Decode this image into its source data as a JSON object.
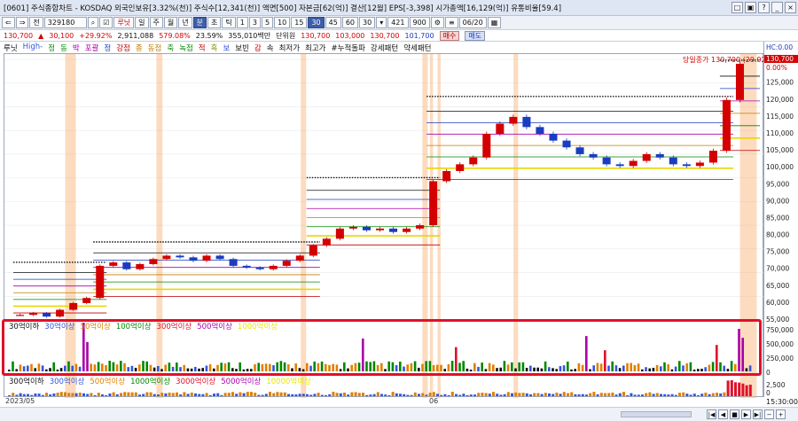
{
  "window": {
    "title": "[0601] 주식종합차트 - KOSDAQ 외국인보유[3.32%(천)] 주식수[12,341(천)] 액면[500] 자본금[62(억)] 결산[12월] EPS[-3,398] 시가총액[16,129(억)] 유통비율[59.4]",
    "buttons": [
      "□",
      "▣",
      "?",
      "_",
      "×"
    ]
  },
  "toolbar": {
    "nav_arrows": [
      "⇐",
      "⇒"
    ],
    "market": "전",
    "code": "329180",
    "search_icon": "search-icon",
    "check": "☑",
    "name_tag": "루닛",
    "periods": [
      "일",
      "주",
      "월",
      "년",
      "분",
      "초",
      "틱"
    ],
    "active_period": "분",
    "numbers": [
      "1",
      "3",
      "5",
      "10",
      "15",
      "30",
      "45",
      "60",
      "30"
    ],
    "active_number": "30",
    "count": "421",
    "count_total": "900",
    "date": "06/20"
  },
  "pricebar": {
    "price": "130,700",
    "change": "30,100",
    "change_pct": "+29.92%",
    "volume": "2,911,088",
    "amount": "579.08%",
    "turnover": "23.59%",
    "value": "355,010백만",
    "trade": "단위원",
    "open": "130,700",
    "high": "103,000",
    "low": "130,700",
    "close": "101,700",
    "buy": "매수",
    "sell": "매도"
  },
  "legend": {
    "items": [
      {
        "label": "루닛",
        "color": "#111111"
      },
      {
        "label": "High-",
        "color": "#3355dd"
      },
      {
        "label": "정",
        "color": "#008800"
      },
      {
        "label": "동",
        "color": "#008800"
      },
      {
        "label": "박",
        "color": "#aa00aa"
      },
      {
        "label": "포괄",
        "color": "#aa00aa"
      },
      {
        "label": "정",
        "color": "#1a3cc0"
      },
      {
        "label": "강점",
        "color": "#c00000"
      },
      {
        "label": "종",
        "color": "#c08000"
      },
      {
        "label": "동점",
        "color": "#c08000"
      },
      {
        "label": "축",
        "color": "#008800"
      },
      {
        "label": "녹점",
        "color": "#008800"
      },
      {
        "label": "적",
        "color": "#c00000"
      },
      {
        "label": "흑",
        "color": "#808000"
      },
      {
        "label": "보",
        "color": "#3355dd"
      },
      {
        "label": "보빈",
        "color": "#111111"
      },
      {
        "label": "감",
        "color": "#c00000"
      },
      {
        "label": "속",
        "color": "#111111"
      },
      {
        "label": "최저가",
        "color": "#111111"
      },
      {
        "label": "최고가",
        "color": "#111111"
      },
      {
        "label": "#누적돌파",
        "color": "#111111"
      },
      {
        "label": "강세패턴",
        "color": "#111111"
      },
      {
        "label": "약세패턴",
        "color": "#111111"
      }
    ],
    "annotation": "당일종가 130,700 (29.92%)"
  },
  "volume_legend_top": [
    {
      "label": "30억이하",
      "color": "#111111"
    },
    {
      "label": "30억이상",
      "color": "#3355dd"
    },
    {
      "label": "50억이상",
      "color": "#e08000"
    },
    {
      "label": "100억이상",
      "color": "#008800"
    },
    {
      "label": "300억이상",
      "color": "#e0102a"
    },
    {
      "label": "500억이상",
      "color": "#aa00aa"
    },
    {
      "label": "1000억이상",
      "color": "#e8e800"
    }
  ],
  "volume_legend_bottom": [
    {
      "label": "300억이하",
      "color": "#111111"
    },
    {
      "label": "300억이상",
      "color": "#3355dd"
    },
    {
      "label": "500억이상",
      "color": "#e08000"
    },
    {
      "label": "1000억이상",
      "color": "#008800"
    },
    {
      "label": "3000억이상",
      "color": "#e0102a"
    },
    {
      "label": "5000억이상",
      "color": "#aa00aa"
    },
    {
      "label": "10000억이상",
      "color": "#e8e800"
    }
  ],
  "yaxis_price": {
    "header": "HC:0.00",
    "labels": [
      "130,700",
      "0.00%",
      "125,000",
      "120,000",
      "115,000",
      "110,000",
      "105,000",
      "100,000",
      "95,000",
      "90,000",
      "85,000",
      "80,000",
      "75,000",
      "70,000",
      "65,000",
      "60,000",
      "55,000"
    ],
    "values": [
      130700,
      null,
      125000,
      120000,
      115000,
      110000,
      105000,
      100000,
      95000,
      90000,
      85000,
      80000,
      75000,
      70000,
      65000,
      60000,
      55000
    ]
  },
  "yaxis_volume": {
    "labels": [
      "750,000",
      "500,000",
      "250,000",
      "0"
    ]
  },
  "yaxis_volume2": {
    "labels": [
      "2,500",
      "0"
    ]
  },
  "xaxis": {
    "labels": [
      "2023/05",
      "06",
      "15:30:00"
    ]
  },
  "chart_data": {
    "type": "candlestick",
    "series": [
      {
        "name": "루닛",
        "values": [
          56500,
          57000,
          56000,
          58000,
          60000,
          61500,
          71000,
          72000,
          70000,
          71500,
          73000,
          74000,
          73500,
          72500,
          74000,
          73000,
          71000,
          70500,
          70000,
          71000,
          72500,
          74000,
          77000,
          79000,
          82000,
          82500,
          81500,
          82000,
          81000,
          82000,
          83000,
          96000,
          99000,
          101000,
          103000,
          110000,
          113000,
          115000,
          112000,
          110000,
          108000,
          106000,
          104000,
          103000,
          101000,
          100500,
          102000,
          104000,
          103000,
          101000,
          100500,
          101500,
          105000,
          120000,
          130700
        ]
      }
    ],
    "ylim": [
      55000,
      132000
    ]
  },
  "colors": {
    "up": "#d40000",
    "down": "#1a3cc0",
    "highlight": "#f8b070",
    "box": "#e0102a"
  }
}
